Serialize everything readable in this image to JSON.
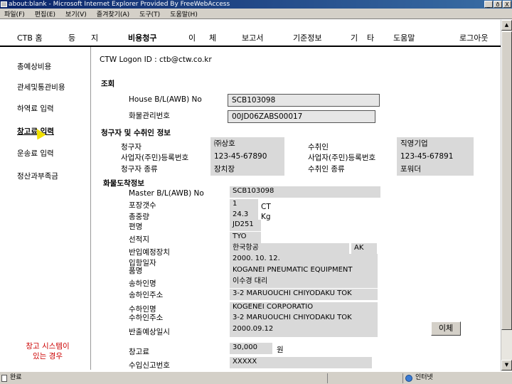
{
  "window": {
    "title": "about:blank - Microsoft Internet Explorer Provided By FreeWebAccess",
    "buttons": [
      "_",
      "ð",
      "X"
    ]
  },
  "menu": [
    "파일(F)",
    "편집(E)",
    "보기(V)",
    "즐겨찾기(A)",
    "도구(T)",
    "도움말(H)"
  ],
  "topnav": {
    "items": [
      "CTB 홈",
      "등",
      "지",
      "비용청구",
      "이",
      "체",
      "보고서",
      "기준정보",
      "기",
      "타",
      "도움말",
      "로그아웃"
    ]
  },
  "sidenav": {
    "items": [
      "총예상비용",
      "관세및통관비용",
      "하역료 입력",
      "창고료 입력",
      "운송료 입력",
      "정산과부족금"
    ],
    "note": "창고 시스템이\n있는 경우"
  },
  "main": {
    "logon": "CTW Logon ID : ctb@ctw.co.kr",
    "search": {
      "section": "조회",
      "house_bl_label": "House B/L(AWB) No",
      "house_bl_value": "SCB103098",
      "cargo_no_label": "화물관리번호",
      "cargo_no_value": "00JD06ZABS00017"
    },
    "parties": {
      "section": "청구자 및 수취인 정보",
      "claimant_label": "청구자",
      "claimant_value": "㈜상호",
      "claimant_reg_label": "사업자(주민)등록번호",
      "claimant_reg_value": "123-45-67890",
      "claimant_type_label": "청구자 종류",
      "claimant_type_value": "장치장",
      "payee_label": "수취인",
      "payee_value": "직영기업",
      "payee_reg_label": "사업자(주민)등록번호",
      "payee_reg_value": "123-45-67891",
      "payee_type_label": "수취인 종류",
      "payee_type_value": "포워더"
    },
    "arrival": {
      "section": "화물도착정보",
      "master_bl_label": "Master B/L(AWB) No",
      "master_bl_value": "SCB103098",
      "packages_label": "포장갯수",
      "packages_value": "1",
      "packages_unit": "CT",
      "weight_label": "총중량",
      "weight_value": "24.3",
      "weight_unit": "Kg",
      "flight_label": "편명",
      "flight_value": "JD251",
      "origin_label": "선적지",
      "origin_value": "TYO",
      "storage_label": "반입예정장치",
      "storage_value": "한국항공",
      "storage_code": "AK",
      "entry_date_label": "입항일자",
      "entry_date_value": "2000. 10. 12.",
      "item_label": "품명",
      "item_value": "KOGANEI PNEUMATIC EQUIPMENT",
      "shipper_name_label": "송하인명",
      "shipper_name_value": "이수경 대리",
      "shipper_addr_label": "송하인주소",
      "shipper_addr_value": "3-2 MARUOUCHI CHIYODAKU TOK",
      "consignee_name_label": "수하인명",
      "consignee_name_value": "KOGENEI CORPORATIO",
      "consignee_addr_label": "수하인주소",
      "consignee_addr_value": "3-2 MARUOUCHI CHIYODAKU TOK",
      "release_label": "반출예상일시",
      "release_value": "2000.09.12",
      "cancel_button": "이체"
    },
    "fees": {
      "storage_fee_label": "창고료",
      "storage_fee_value": "30,000",
      "storage_fee_unit": "원",
      "import_no_label": "수입신고번호",
      "import_no_value": "XXXXX"
    }
  },
  "status": {
    "left": "완료",
    "zone": "인터넷"
  }
}
